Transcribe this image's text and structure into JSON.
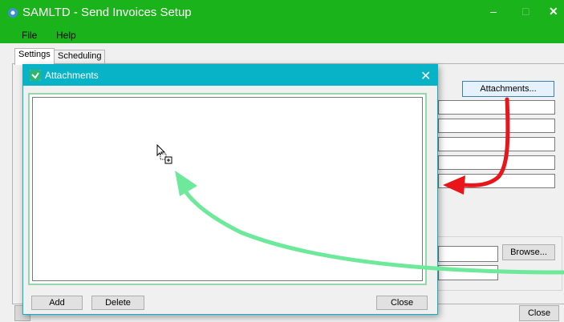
{
  "window": {
    "title": "SAMLTD - Send Invoices Setup",
    "minimize": "–",
    "maximize": "□",
    "close": "✕"
  },
  "menu": [
    {
      "label": "File"
    },
    {
      "label": "Help"
    }
  ],
  "tabs": [
    {
      "label": "Settings",
      "active": true
    },
    {
      "label": "Scheduling",
      "active": false
    }
  ],
  "settings": {
    "attachments_button": "Attachments...",
    "browse_button": "Browse...",
    "close_button": "Close"
  },
  "dialog": {
    "title": "Attachments",
    "close": "✕",
    "add_button": "Add",
    "delete_button": "Delete",
    "close_button": "Close"
  },
  "colors": {
    "title_bar": "#1bb31b",
    "dialog_title_bar": "#08b3c7",
    "red_arrow": "#e8151b",
    "green_arrow": "#6ee89a"
  }
}
